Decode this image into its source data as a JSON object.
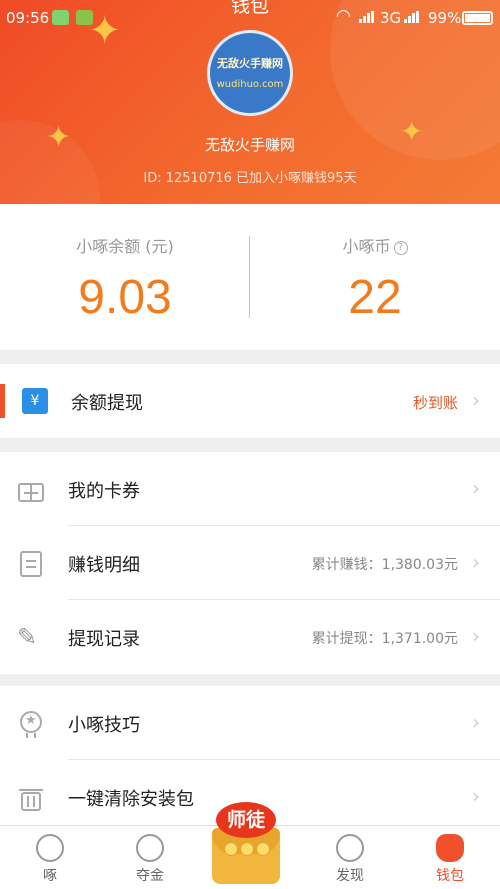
{
  "status_bar": {
    "time": "09:56",
    "network": "3G",
    "battery": "99%"
  },
  "page_title": "钱包",
  "profile": {
    "avatar_text_top": "无敌火手赚网",
    "avatar_text_bottom": "wudihuo.com",
    "name": "无敌火手赚网",
    "id_line": "ID: 12510716  已加入小啄赚钱95天"
  },
  "balance": {
    "left_label": "小啄余额 (元)",
    "left_value": "9.03",
    "right_label": "小啄币",
    "right_value": "22"
  },
  "withdraw": {
    "label": "余额提现",
    "tag": "秒到账"
  },
  "menu": [
    {
      "label": "我的卡券",
      "extra": ""
    },
    {
      "label": "赚钱明细",
      "extra": "累计赚钱：1,380.03元"
    },
    {
      "label": "提现记录",
      "extra": "累计提现：1,371.00元"
    }
  ],
  "menu2": [
    {
      "label": "小啄技巧"
    },
    {
      "label": "一键清除安装包"
    }
  ],
  "tabbar": {
    "tabs": [
      {
        "label": "啄",
        "icon": "bird-icon"
      },
      {
        "label": "夺金",
        "icon": "bulb-icon"
      },
      {
        "label": "发现",
        "icon": "planet-icon"
      },
      {
        "label": "钱包",
        "icon": "wallet-bag-icon"
      }
    ],
    "center_badge": "师徒"
  },
  "colors": {
    "header": "#f04a26",
    "accent": "#f07c1e",
    "tag": "#e05a2a"
  }
}
